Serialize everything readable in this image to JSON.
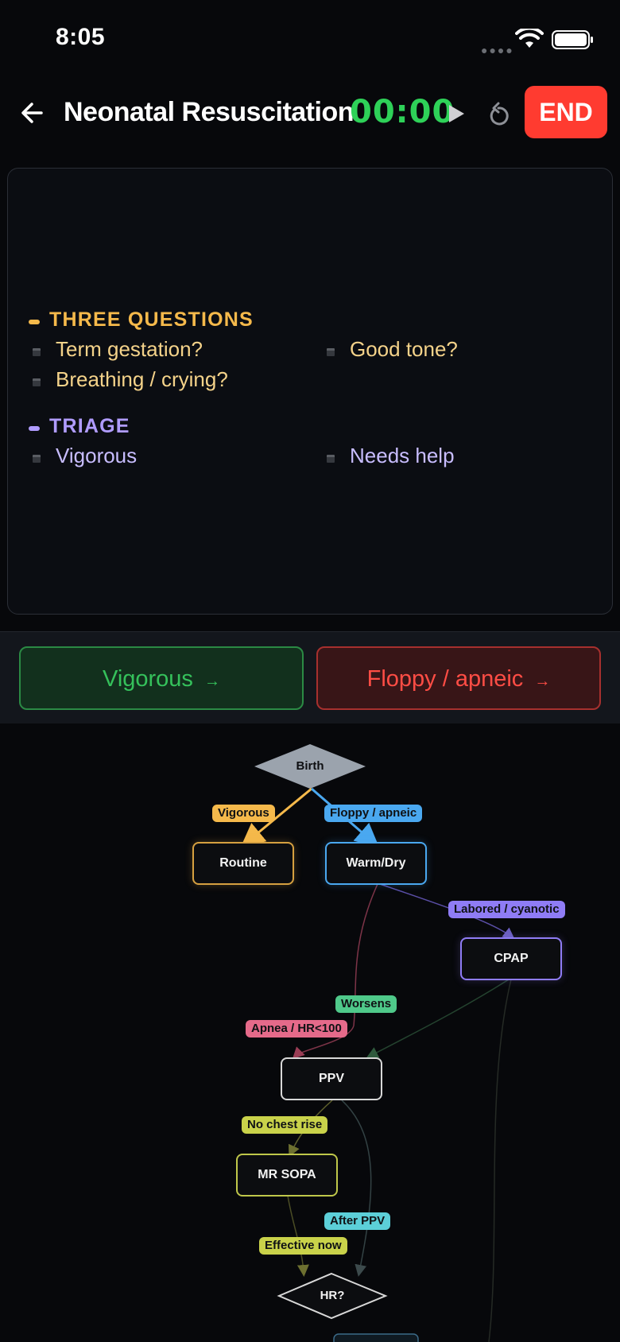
{
  "status": {
    "time": "8:05"
  },
  "header": {
    "title": "Neonatal Resuscitation",
    "timer": "00:00",
    "end_label": "END"
  },
  "panel": {
    "sections": [
      {
        "title": "THREE QUESTIONS",
        "color": "#f5b94b",
        "items": [
          "Term gestation?",
          "Good tone?",
          "Breathing / crying?"
        ]
      },
      {
        "title": "TRIAGE",
        "color": "#b09cff",
        "items": [
          "Vigorous",
          "Needs help"
        ]
      }
    ]
  },
  "choices": [
    {
      "label": "Vigorous",
      "arrow": "→"
    },
    {
      "label": "Floppy / apneic",
      "arrow": "→"
    }
  ],
  "flowchart": {
    "nodes": {
      "birth": "Birth",
      "routine": "Routine",
      "warm_dry": "Warm/Dry",
      "cpap": "CPAP",
      "ppv": "PPV",
      "mr_sopa": "MR SOPA",
      "hr": "HR?"
    },
    "edges": {
      "vigorous": "Vigorous",
      "floppy": "Floppy / apneic",
      "labored": "Labored / cyanotic",
      "worsens": "Worsens",
      "apnea": "Apnea / HR<100",
      "no_chest_rise": "No chest rise",
      "after_ppv": "After PPV",
      "effective_now": "Effective now"
    },
    "colors": {
      "vigorous": "#f5b94b",
      "floppy": "#4aa8f0",
      "labored": "#8f7cf5",
      "worsens": "#4fc98a",
      "apnea": "#e56a8a",
      "no_chest_rise": "#c9d24a",
      "after_ppv": "#5ccfd8",
      "effective_now": "#c9d24a"
    }
  }
}
